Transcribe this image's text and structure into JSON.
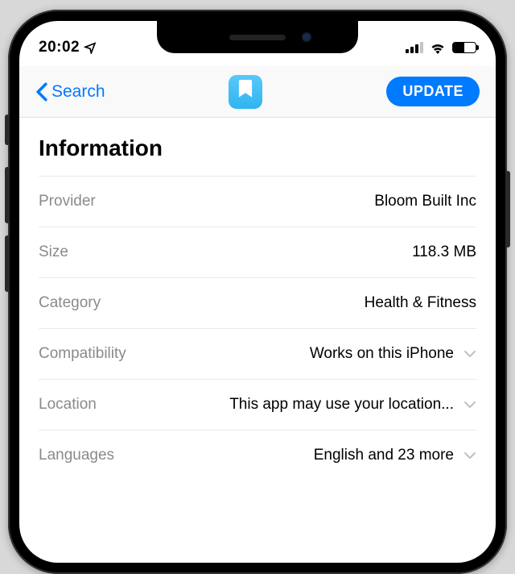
{
  "statusBar": {
    "time": "20:02"
  },
  "nav": {
    "backLabel": "Search",
    "actionLabel": "UPDATE"
  },
  "section": {
    "title": "Information"
  },
  "rows": {
    "provider": {
      "label": "Provider",
      "value": "Bloom Built Inc"
    },
    "size": {
      "label": "Size",
      "value": "118.3 MB"
    },
    "category": {
      "label": "Category",
      "value": "Health & Fitness"
    },
    "compat": {
      "label": "Compatibility",
      "value": "Works on this iPhone"
    },
    "location": {
      "label": "Location",
      "value": "This app may use your location..."
    },
    "lang": {
      "label": "Languages",
      "value": "English and 23 more"
    }
  }
}
